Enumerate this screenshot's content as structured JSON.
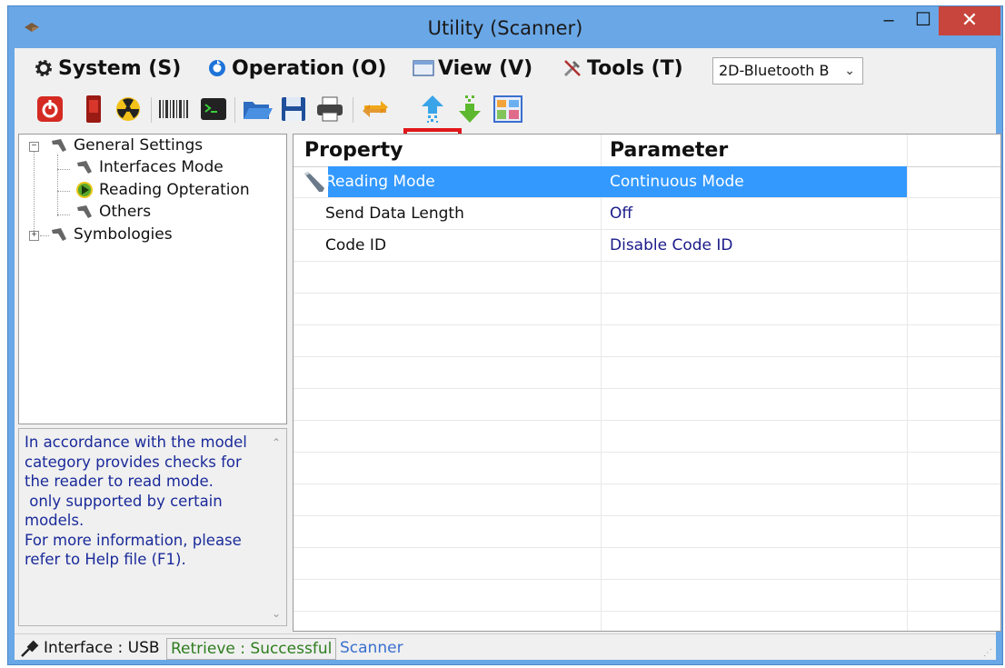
{
  "window": {
    "title": "Utility (Scanner)",
    "minimize": "–",
    "maximize": "☐",
    "close": "✕"
  },
  "menu": {
    "system": "System (S)",
    "operation": "Operation (O)",
    "view": "View (V)",
    "tools": "Tools (T)"
  },
  "device_select": {
    "value": "2D-Bluetooth B"
  },
  "toolbar": {
    "icons": [
      "power-icon",
      "device-icon",
      "radiation-icon",
      "barcode-icon",
      "terminal-icon",
      "open-folder-icon",
      "save-icon",
      "print-icon",
      "sync-icon",
      "upload-icon",
      "download-icon",
      "layout-icon"
    ],
    "highlighted": "upload-icon",
    "highlight_color": "#e0161a"
  },
  "tree": {
    "general_settings": "General Settings",
    "interfaces_mode": "Interfaces Mode",
    "reading_operation": "Reading Opteration",
    "others": "Others",
    "symbologies": "Symbologies"
  },
  "help": {
    "text": "In accordance with the model\ncategory provides checks for\nthe reader to read mode.\n only supported by certain\nmodels.\nFor more information, please\nrefer to Help file (F1)."
  },
  "grid": {
    "headers": {
      "property": "Property",
      "parameter": "Parameter"
    },
    "rows": [
      {
        "property": "Reading Mode",
        "parameter": "Continuous Mode",
        "selected": true
      },
      {
        "property": "Send Data Length",
        "parameter": "Off",
        "selected": false
      },
      {
        "property": "Code ID",
        "parameter": "Disable Code ID",
        "selected": false
      }
    ],
    "selection_color": "#3399ff",
    "parameter_color": "#1a1a8a"
  },
  "status": {
    "interface": "Interface : USB",
    "retrieve": "Retrieve : Successful",
    "mode": "Scanner",
    "retrieve_color": "#2e7d1e",
    "mode_color": "#3a6fcf"
  }
}
